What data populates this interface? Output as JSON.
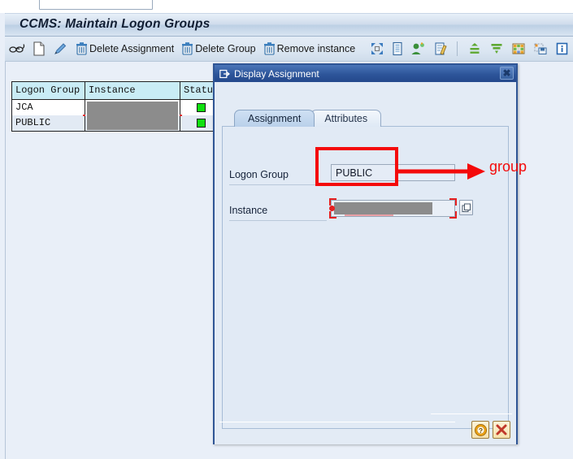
{
  "window": {
    "title": "CCMS: Maintain Logon Groups"
  },
  "toolbar": {
    "items": [
      {
        "icon": "glasses-display-icon",
        "label": ""
      },
      {
        "icon": "new-document-icon",
        "label": ""
      },
      {
        "icon": "pencil-edit-icon",
        "label": ""
      },
      {
        "icon": "trash-icon",
        "label": "Delete Assignment"
      },
      {
        "icon": "trash-icon",
        "label": "Delete Group"
      },
      {
        "icon": "trash-icon",
        "label": "Remove instance"
      },
      {
        "icon": "expand-arrows-icon",
        "label": ""
      },
      {
        "icon": "server-list-icon",
        "label": ""
      },
      {
        "icon": "users-icon",
        "label": ""
      },
      {
        "icon": "document-check-icon",
        "label": ""
      },
      {
        "icon": "sort-ascending-icon",
        "label": ""
      },
      {
        "icon": "filter-icon",
        "label": ""
      },
      {
        "icon": "grid-colors-icon",
        "label": ""
      },
      {
        "icon": "save-layout-icon",
        "label": ""
      },
      {
        "icon": "info-icon",
        "label": ""
      }
    ]
  },
  "table": {
    "columns": [
      "Logon Group",
      "Instance",
      "Status"
    ],
    "rows": [
      {
        "logon_group": "JCA",
        "instance": "",
        "status": "green"
      },
      {
        "logon_group": "PUBLIC",
        "instance": "",
        "status": "green"
      }
    ]
  },
  "dialog": {
    "title": "Display Assignment",
    "title_icon": "dialog-window-icon",
    "close_label": "✖",
    "tabs": [
      {
        "label": "Assignment",
        "active": true
      },
      {
        "label": "Attributes",
        "active": false
      }
    ],
    "fields": [
      {
        "label": "Logon Group",
        "value": "PUBLIC",
        "placeholder": ""
      },
      {
        "label": "Instance",
        "value": "",
        "placeholder": ""
      }
    ],
    "buttons": [
      {
        "name": "help-button",
        "glyph": "?"
      },
      {
        "name": "cancel-button",
        "glyph": "✕"
      }
    ]
  },
  "annotation": {
    "text": "group",
    "color": "#f40a0a"
  }
}
